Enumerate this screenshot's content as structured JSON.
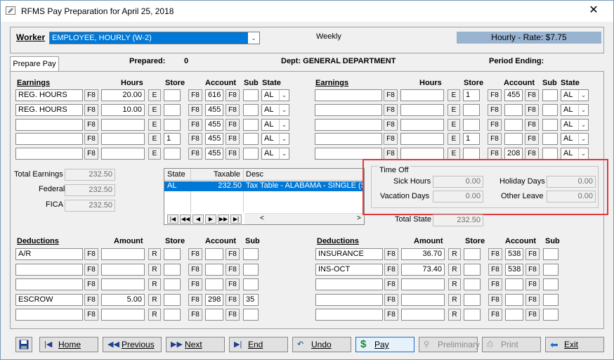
{
  "window": {
    "title": "RFMS Pay Preparation for April 25, 2018",
    "close_glyph": "✕"
  },
  "worker": {
    "label": "Worker",
    "selected": "EMPLOYEE, HOURLY (W-2)",
    "frequency": "Weekly",
    "rate_text": "Hourly - Rate: $7.75"
  },
  "tab": {
    "label": "Prepare Pay"
  },
  "info": {
    "prepared_label": "Prepared:",
    "prepared_value": "0",
    "dept": "Dept: GENERAL DEPARTMENT",
    "period_ending_label": "Period Ending:"
  },
  "earnings_headers": {
    "earnings": "Earnings",
    "hours": "Hours",
    "store": "Store",
    "account": "Account",
    "sub": "Sub",
    "state": "State"
  },
  "btn_f8": "F8",
  "btn_e": "E",
  "btn_r": "R",
  "earnings_left": [
    {
      "desc": "REG. HOURS",
      "hours": "20.00",
      "store": "",
      "account": "616",
      "sub": "",
      "state": "AL"
    },
    {
      "desc": "REG. HOURS",
      "hours": "10.00",
      "store": "",
      "account": "455",
      "sub": "",
      "state": "AL"
    },
    {
      "desc": "",
      "hours": "",
      "store": "",
      "account": "455",
      "sub": "",
      "state": "AL"
    },
    {
      "desc": "",
      "hours": "",
      "store": "1",
      "account": "455",
      "sub": "",
      "state": "AL"
    },
    {
      "desc": "",
      "hours": "",
      "store": "",
      "account": "455",
      "sub": "",
      "state": "AL"
    }
  ],
  "earnings_right": [
    {
      "desc": "",
      "hours": "",
      "store": "1",
      "account": "455",
      "sub": "",
      "state": "AL"
    },
    {
      "desc": "",
      "hours": "",
      "store": "",
      "account": "",
      "sub": "",
      "state": "AL"
    },
    {
      "desc": "",
      "hours": "",
      "store": "",
      "account": "",
      "sub": "",
      "state": "AL"
    },
    {
      "desc": "",
      "hours": "",
      "store": "1",
      "account": "",
      "sub": "",
      "state": "AL"
    },
    {
      "desc": "",
      "hours": "",
      "store": "",
      "account": "208",
      "sub": "",
      "state": "AL"
    }
  ],
  "totals": {
    "total_earnings_label": "Total Earnings",
    "total_earnings": "232.50",
    "federal_label": "Federal",
    "federal": "232.50",
    "fica_label": "FICA",
    "fica": "232.50",
    "total_state_label": "Total State",
    "total_state": "232.50"
  },
  "state_grid": {
    "headers": {
      "state": "State",
      "taxable": "Taxable",
      "desc": "Desc"
    },
    "rows": [
      {
        "state": "AL",
        "taxable": "232.50",
        "desc": "Tax Table - ALABAMA - SINGLE (S"
      }
    ],
    "nav": [
      "|◀",
      "◀◀",
      "◀",
      "▶",
      "▶▶",
      "▶|"
    ],
    "scroll_left": "<",
    "scroll_right": ">"
  },
  "time_off": {
    "title": "Time Off",
    "sick_label": "Sick Hours",
    "sick": "0.00",
    "holiday_label": "Holiday Days",
    "holiday": "0.00",
    "vacation_label": "Vacation Days",
    "vacation": "0.00",
    "other_label": "Other Leave",
    "other": "0.00"
  },
  "deductions_headers": {
    "deductions": "Deductions",
    "amount": "Amount",
    "store": "Store",
    "account": "Account",
    "sub": "Sub"
  },
  "deductions_left": [
    {
      "desc": "A/R",
      "amount": "",
      "store": "",
      "account": "",
      "sub": ""
    },
    {
      "desc": "",
      "amount": "",
      "store": "",
      "account": "",
      "sub": ""
    },
    {
      "desc": "",
      "amount": "",
      "store": "",
      "account": "",
      "sub": ""
    },
    {
      "desc": "ESCROW",
      "amount": "5.00",
      "store": "",
      "account": "298",
      "sub": "35"
    },
    {
      "desc": "",
      "amount": "",
      "store": "",
      "account": "",
      "sub": ""
    }
  ],
  "deductions_right": [
    {
      "desc": "INSURANCE",
      "amount": "36.70",
      "store": "",
      "account": "538",
      "sub": ""
    },
    {
      "desc": "INS-OCT",
      "amount": "73.40",
      "store": "",
      "account": "538",
      "sub": ""
    },
    {
      "desc": "",
      "amount": "",
      "store": "",
      "account": "",
      "sub": ""
    },
    {
      "desc": "",
      "amount": "",
      "store": "",
      "account": "",
      "sub": ""
    },
    {
      "desc": "",
      "amount": "",
      "store": "",
      "account": "",
      "sub": ""
    }
  ],
  "bottom_buttons": {
    "home": "Home",
    "previous": "Previous",
    "next": "Next",
    "end": "End",
    "undo": "Undo",
    "pay": "Pay",
    "preliminary": "Preliminary",
    "print": "Print",
    "exit": "Exit"
  },
  "colors": {
    "selection": "#0078d7",
    "rate_bg": "#99b4d1",
    "highlight_border": "#e0383e"
  }
}
